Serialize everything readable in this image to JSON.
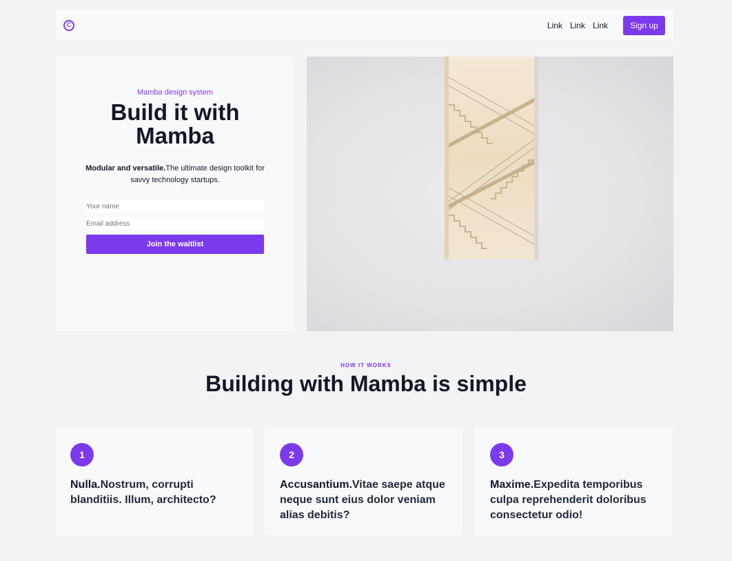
{
  "nav": {
    "logo_letter": "C",
    "links": [
      "Link",
      "Link",
      "Link"
    ],
    "signup_label": "Sign up"
  },
  "hero": {
    "eyebrow": "Mamba design system",
    "title_line1": "Build it with",
    "title_line2": "Mamba",
    "desc_bold": "Modular and versatile.",
    "desc_rest": "The ultimate design toolkit for savvy technology startups.",
    "name_placeholder": "Your name",
    "email_placeholder": "Email address",
    "join_label": "Join the waitlist"
  },
  "how": {
    "eyebrow": "HOW IT WORKS",
    "title": "Building with Mamba is simple"
  },
  "cards": [
    {
      "num": "1",
      "bold": "Nulla.",
      "rest": "Nostrum, corrupti blanditiis. Illum, architecto?"
    },
    {
      "num": "2",
      "bold": "Accusantium.",
      "rest": "Vitae saepe atque neque sunt eius dolor veniam alias debitis?"
    },
    {
      "num": "3",
      "bold": "Maxime.",
      "rest": "Expedita temporibus culpa reprehenderit doloribus consectetur odio!"
    }
  ],
  "colors": {
    "accent": "#7c3aed",
    "background": "#f2f3f5",
    "card": "#f8f9fb"
  }
}
